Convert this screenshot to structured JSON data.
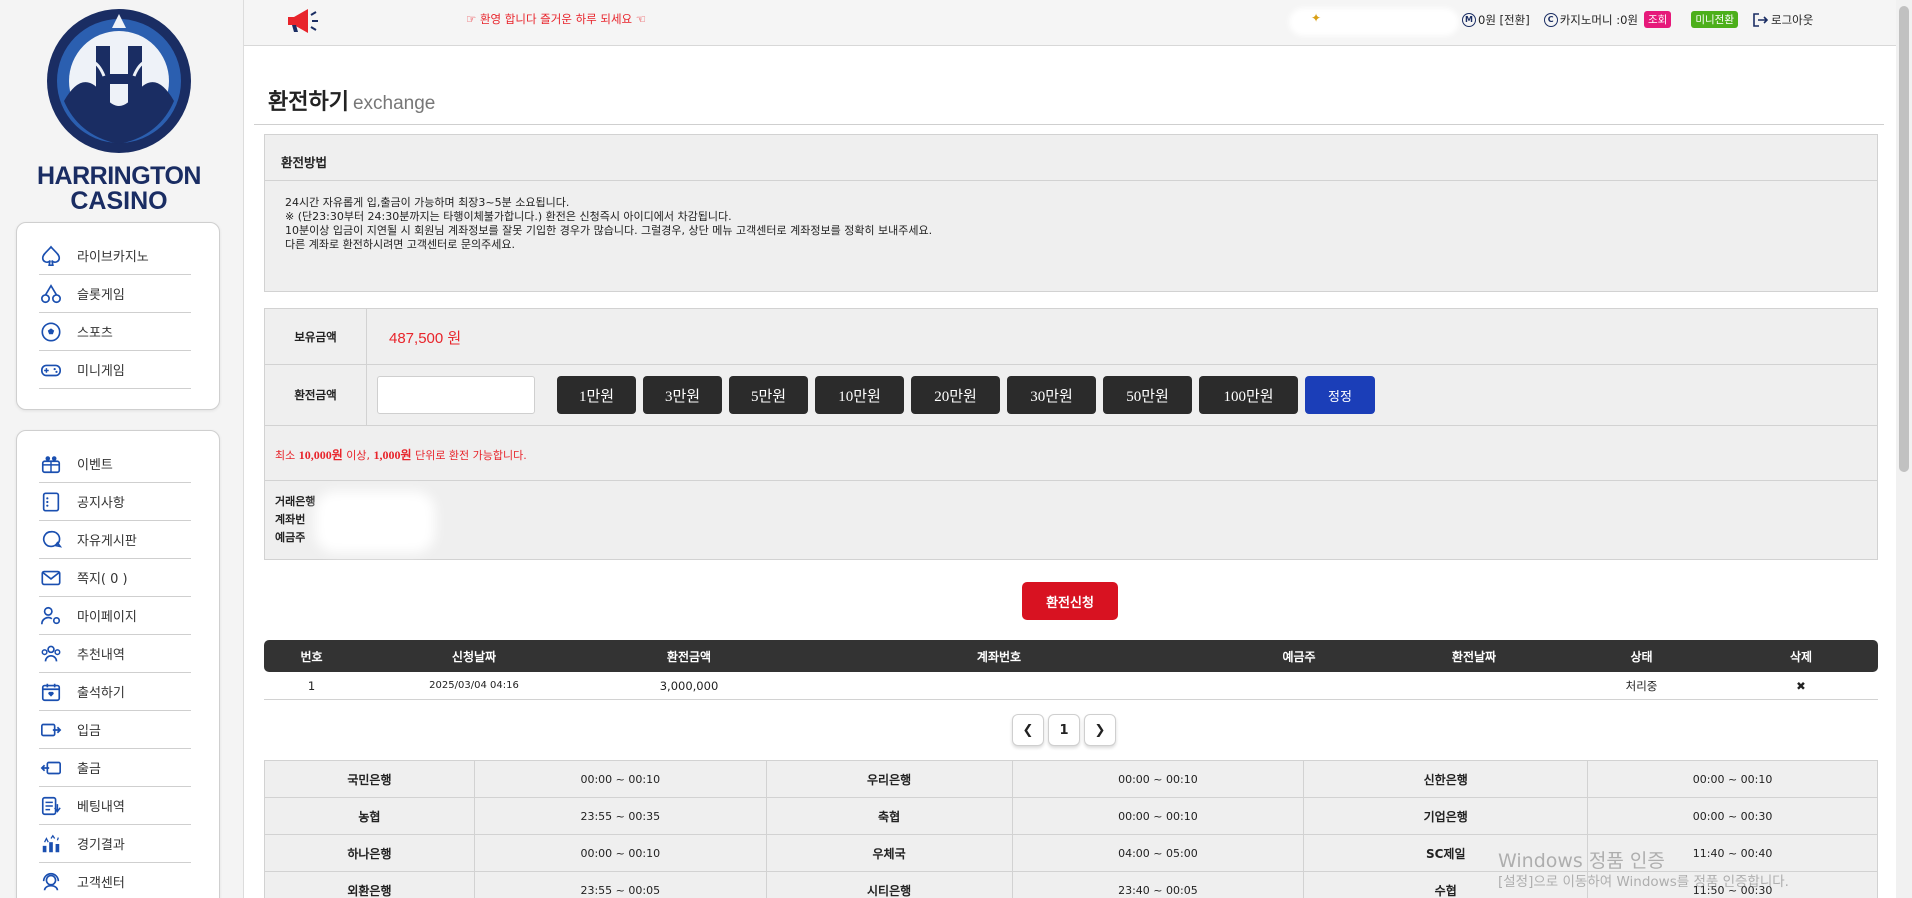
{
  "colors": {
    "brand": "#1a2d63",
    "accent_red": "#e8242b",
    "submit_red": "#d81221",
    "confirm_blue": "#1b3eb8",
    "dark_button": "#2b2b2b"
  },
  "logo": {
    "line1": "HARRINGTON",
    "line2": "CASINO"
  },
  "sidebar": {
    "group1": [
      {
        "label": "라이브카지노",
        "icon": "spade-icon"
      },
      {
        "label": "슬롯게임",
        "icon": "cherry-icon"
      },
      {
        "label": "스포츠",
        "icon": "soccer-ball-icon"
      },
      {
        "label": "미니게임",
        "icon": "gamepad-icon"
      }
    ],
    "group2": [
      {
        "label": "이벤트",
        "icon": "gift-icon"
      },
      {
        "label": "공지사항",
        "icon": "notice-icon"
      },
      {
        "label": "자유게시판",
        "icon": "board-icon"
      },
      {
        "label": "쪽지( 0 )",
        "icon": "mail-icon"
      },
      {
        "label": "마이페이지",
        "icon": "user-gear-icon"
      },
      {
        "label": "추천내역",
        "icon": "users-icon"
      },
      {
        "label": "출석하기",
        "icon": "calendar-icon"
      },
      {
        "label": "입금",
        "icon": "deposit-icon"
      },
      {
        "label": "출금",
        "icon": "withdraw-icon"
      },
      {
        "label": "베팅내역",
        "icon": "bet-history-icon"
      },
      {
        "label": "경기결과",
        "icon": "results-icon"
      },
      {
        "label": "고객센터",
        "icon": "support-icon"
      }
    ]
  },
  "topbar": {
    "welcome": "☞ 환영 합니다 즐거운 하루 되세요 ☜",
    "money": "0원 [전환]",
    "casino_money": "카지노머니 :0원",
    "badge_view": "조회",
    "badge_mini": "미니전환",
    "logout": "로그아웃"
  },
  "page": {
    "title": "환전하기",
    "subtitle": "exchange",
    "method_title": "환전방법",
    "method_lines": [
      "24시간 자유롭게 입,출금이 가능하며 최장3~5분 소요됩니다.",
      "※ (단23:30부터 24:30분까지는 타행이체불가합니다.) 환전은 신청즉시 아이디에서 차감됩니다.",
      "10분이상 입금이 지연될 시 회원님 계좌정보를 잘못 기입한 경우가 많습니다. 그럴경우, 상단 메뉴 고객센터로 계좌정보를 정확히 보내주세요.",
      "다른 계좌로 환전하시려면 고객센터로 문의주세요."
    ]
  },
  "form": {
    "balance_label": "보유금액",
    "balance_value": "487,500 원",
    "amount_label": "환전금액",
    "amount_input_value": "",
    "amount_buttons": [
      "1만원",
      "3만원",
      "5만원",
      "10만원",
      "20만원",
      "30만원",
      "50만원",
      "100만원"
    ],
    "confirm_button": "정정",
    "min_note_pre": "최소 ",
    "min_note_amt1": "10,000원",
    "min_note_mid": " 이상, ",
    "min_note_amt2": "1,000원",
    "min_note_post": "  단위로 환전 가능합니다.",
    "account_labels": [
      "거래은행",
      "계좌번",
      "예금주"
    ]
  },
  "submit_label": "환전신청",
  "history": {
    "headers": [
      "번호",
      "신청날짜",
      "환전금액",
      "계좌번호",
      "예금주",
      "환전날짜",
      "상태",
      "삭제"
    ],
    "rows": [
      {
        "no": "1",
        "date": "2025/03/04 04:16",
        "amount": "3,000,000",
        "account": "",
        "holder": "",
        "done_date": "",
        "status": "처리중",
        "delete": "✖"
      }
    ]
  },
  "pagination": {
    "current": "1"
  },
  "banks": [
    [
      "국민은행",
      "00:00 ~ 00:10",
      "우리은행",
      "00:00 ~ 00:10",
      "신한은행",
      "00:00 ~ 00:10"
    ],
    [
      "농협",
      "23:55 ~ 00:35",
      "축협",
      "00:00 ~ 00:10",
      "기업은행",
      "00:00 ~ 00:30"
    ],
    [
      "하나은행",
      "00:00 ~ 00:10",
      "우체국",
      "04:00 ~ 05:00",
      "SC제일",
      "11:40 ~ 00:40"
    ],
    [
      "외환은행",
      "23:55 ~ 00:05",
      "시티은행",
      "23:40 ~ 00:05",
      "수협",
      "11:50 ~ 00:30"
    ]
  ],
  "watermark": {
    "line1": "Windows 정품 인증",
    "line2": "[설정]으로 이동하여 Windows를 정품 인증합니다."
  }
}
